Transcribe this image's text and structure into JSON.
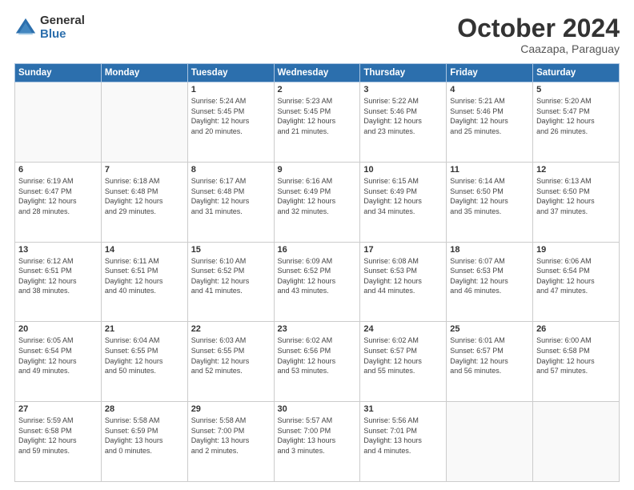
{
  "header": {
    "logo_general": "General",
    "logo_blue": "Blue",
    "month_title": "October 2024",
    "subtitle": "Caazapa, Paraguay"
  },
  "days_of_week": [
    "Sunday",
    "Monday",
    "Tuesday",
    "Wednesday",
    "Thursday",
    "Friday",
    "Saturday"
  ],
  "weeks": [
    [
      {
        "day": "",
        "lines": []
      },
      {
        "day": "",
        "lines": []
      },
      {
        "day": "1",
        "lines": [
          "Sunrise: 5:24 AM",
          "Sunset: 5:45 PM",
          "Daylight: 12 hours",
          "and 20 minutes."
        ]
      },
      {
        "day": "2",
        "lines": [
          "Sunrise: 5:23 AM",
          "Sunset: 5:45 PM",
          "Daylight: 12 hours",
          "and 21 minutes."
        ]
      },
      {
        "day": "3",
        "lines": [
          "Sunrise: 5:22 AM",
          "Sunset: 5:46 PM",
          "Daylight: 12 hours",
          "and 23 minutes."
        ]
      },
      {
        "day": "4",
        "lines": [
          "Sunrise: 5:21 AM",
          "Sunset: 5:46 PM",
          "Daylight: 12 hours",
          "and 25 minutes."
        ]
      },
      {
        "day": "5",
        "lines": [
          "Sunrise: 5:20 AM",
          "Sunset: 5:47 PM",
          "Daylight: 12 hours",
          "and 26 minutes."
        ]
      }
    ],
    [
      {
        "day": "6",
        "lines": [
          "Sunrise: 6:19 AM",
          "Sunset: 6:47 PM",
          "Daylight: 12 hours",
          "and 28 minutes."
        ]
      },
      {
        "day": "7",
        "lines": [
          "Sunrise: 6:18 AM",
          "Sunset: 6:48 PM",
          "Daylight: 12 hours",
          "and 29 minutes."
        ]
      },
      {
        "day": "8",
        "lines": [
          "Sunrise: 6:17 AM",
          "Sunset: 6:48 PM",
          "Daylight: 12 hours",
          "and 31 minutes."
        ]
      },
      {
        "day": "9",
        "lines": [
          "Sunrise: 6:16 AM",
          "Sunset: 6:49 PM",
          "Daylight: 12 hours",
          "and 32 minutes."
        ]
      },
      {
        "day": "10",
        "lines": [
          "Sunrise: 6:15 AM",
          "Sunset: 6:49 PM",
          "Daylight: 12 hours",
          "and 34 minutes."
        ]
      },
      {
        "day": "11",
        "lines": [
          "Sunrise: 6:14 AM",
          "Sunset: 6:50 PM",
          "Daylight: 12 hours",
          "and 35 minutes."
        ]
      },
      {
        "day": "12",
        "lines": [
          "Sunrise: 6:13 AM",
          "Sunset: 6:50 PM",
          "Daylight: 12 hours",
          "and 37 minutes."
        ]
      }
    ],
    [
      {
        "day": "13",
        "lines": [
          "Sunrise: 6:12 AM",
          "Sunset: 6:51 PM",
          "Daylight: 12 hours",
          "and 38 minutes."
        ]
      },
      {
        "day": "14",
        "lines": [
          "Sunrise: 6:11 AM",
          "Sunset: 6:51 PM",
          "Daylight: 12 hours",
          "and 40 minutes."
        ]
      },
      {
        "day": "15",
        "lines": [
          "Sunrise: 6:10 AM",
          "Sunset: 6:52 PM",
          "Daylight: 12 hours",
          "and 41 minutes."
        ]
      },
      {
        "day": "16",
        "lines": [
          "Sunrise: 6:09 AM",
          "Sunset: 6:52 PM",
          "Daylight: 12 hours",
          "and 43 minutes."
        ]
      },
      {
        "day": "17",
        "lines": [
          "Sunrise: 6:08 AM",
          "Sunset: 6:53 PM",
          "Daylight: 12 hours",
          "and 44 minutes."
        ]
      },
      {
        "day": "18",
        "lines": [
          "Sunrise: 6:07 AM",
          "Sunset: 6:53 PM",
          "Daylight: 12 hours",
          "and 46 minutes."
        ]
      },
      {
        "day": "19",
        "lines": [
          "Sunrise: 6:06 AM",
          "Sunset: 6:54 PM",
          "Daylight: 12 hours",
          "and 47 minutes."
        ]
      }
    ],
    [
      {
        "day": "20",
        "lines": [
          "Sunrise: 6:05 AM",
          "Sunset: 6:54 PM",
          "Daylight: 12 hours",
          "and 49 minutes."
        ]
      },
      {
        "day": "21",
        "lines": [
          "Sunrise: 6:04 AM",
          "Sunset: 6:55 PM",
          "Daylight: 12 hours",
          "and 50 minutes."
        ]
      },
      {
        "day": "22",
        "lines": [
          "Sunrise: 6:03 AM",
          "Sunset: 6:55 PM",
          "Daylight: 12 hours",
          "and 52 minutes."
        ]
      },
      {
        "day": "23",
        "lines": [
          "Sunrise: 6:02 AM",
          "Sunset: 6:56 PM",
          "Daylight: 12 hours",
          "and 53 minutes."
        ]
      },
      {
        "day": "24",
        "lines": [
          "Sunrise: 6:02 AM",
          "Sunset: 6:57 PM",
          "Daylight: 12 hours",
          "and 55 minutes."
        ]
      },
      {
        "day": "25",
        "lines": [
          "Sunrise: 6:01 AM",
          "Sunset: 6:57 PM",
          "Daylight: 12 hours",
          "and 56 minutes."
        ]
      },
      {
        "day": "26",
        "lines": [
          "Sunrise: 6:00 AM",
          "Sunset: 6:58 PM",
          "Daylight: 12 hours",
          "and 57 minutes."
        ]
      }
    ],
    [
      {
        "day": "27",
        "lines": [
          "Sunrise: 5:59 AM",
          "Sunset: 6:58 PM",
          "Daylight: 12 hours",
          "and 59 minutes."
        ]
      },
      {
        "day": "28",
        "lines": [
          "Sunrise: 5:58 AM",
          "Sunset: 6:59 PM",
          "Daylight: 13 hours",
          "and 0 minutes."
        ]
      },
      {
        "day": "29",
        "lines": [
          "Sunrise: 5:58 AM",
          "Sunset: 7:00 PM",
          "Daylight: 13 hours",
          "and 2 minutes."
        ]
      },
      {
        "day": "30",
        "lines": [
          "Sunrise: 5:57 AM",
          "Sunset: 7:00 PM",
          "Daylight: 13 hours",
          "and 3 minutes."
        ]
      },
      {
        "day": "31",
        "lines": [
          "Sunrise: 5:56 AM",
          "Sunset: 7:01 PM",
          "Daylight: 13 hours",
          "and 4 minutes."
        ]
      },
      {
        "day": "",
        "lines": []
      },
      {
        "day": "",
        "lines": []
      }
    ]
  ]
}
